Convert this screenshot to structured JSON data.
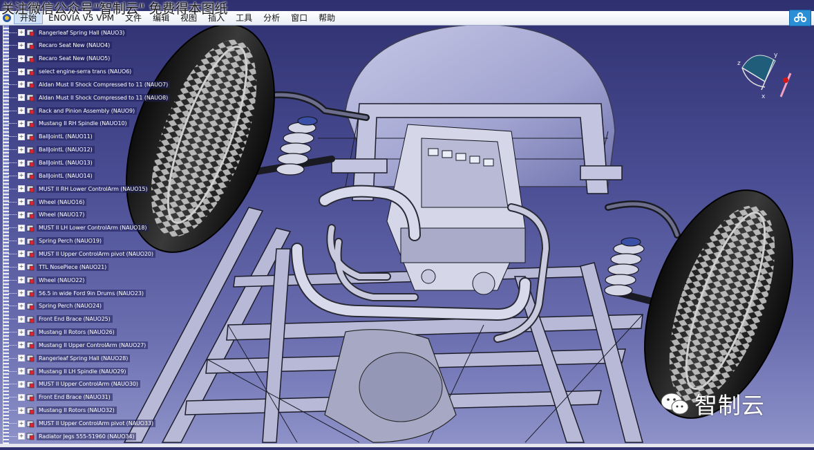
{
  "watermark_top": "关注微信公众号\"智制云\" 免费得本图纸",
  "menu": {
    "items": [
      "开始",
      "ENOVIA V5 VPM",
      "文件",
      "编辑",
      "视图",
      "插入",
      "工具",
      "分析",
      "窗口",
      "帮助"
    ],
    "active_index": 0
  },
  "tree": {
    "items": [
      "Rangerleaf Spring Hall (NAUO3)",
      "Recaro Seat New (NAUO4)",
      "Recaro Seat New (NAUO5)",
      "select engine-serra trans (NAUO6)",
      "Aldan Must II Shock Compressed to 11 (NAUO7)",
      "Aldan Must II Shock Compressed to 11 (NAUO8)",
      "Rack and Pinion Assembly (NAUO9)",
      "Mustang II RH Spindle (NAUO10)",
      "BallJointL (NAUO11)",
      "BallJointL (NAUO12)",
      "BallJointL (NAUO13)",
      "BallJointL (NAUO14)",
      "MUST II RH Lower ControlArm (NAUO15)",
      "Wheel (NAUO16)",
      "Wheel (NAUO17)",
      "MUST II LH Lower ControlArm (NAUO18)",
      "Spring Perch (NAUO19)",
      "MUST II Upper ControlArm pivot (NAUO20)",
      "TTL NosePiece (NAUO21)",
      "Wheel (NAUO22)",
      "56.5 in wide Ford 9in Drums (NAUO23)",
      "Spring Perch (NAUO24)",
      "Front End Brace (NAUO25)",
      "Mustang II Rotors (NAUO26)",
      "Mustang II Upper ControlArm (NAUO27)",
      "Rangerleaf Spring Hall (NAUO28)",
      "Mustang II LH Spindle (NAUO29)",
      "MUST II Upper ControlArm (NAUO30)",
      "Front End Brace (NAUO31)",
      "Mustang II Rotors (NAUO32)",
      "MUST II Upper ControlArm pivot (NAUO33)",
      "Radiator Jegs 555-51960 (NAUO34)"
    ]
  },
  "watermark_br": "智制云",
  "colors": {
    "background_top": "#2e3070",
    "background_bottom": "#8f93c9",
    "tree_text": "#ffffff"
  }
}
